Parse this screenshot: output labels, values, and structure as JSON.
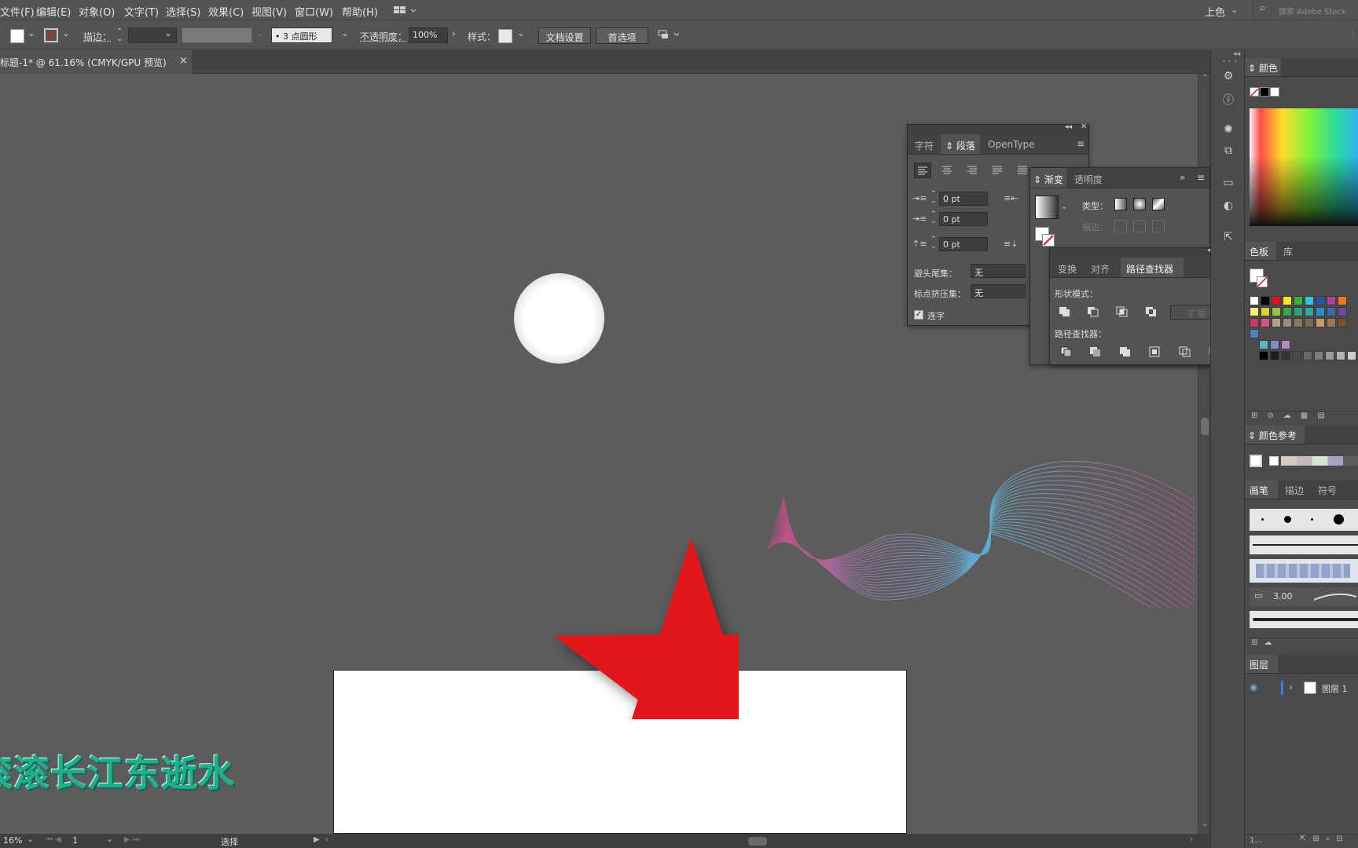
{
  "menubar": {
    "items": [
      "文件(F)",
      "编辑(E)",
      "对象(O)",
      "文字(T)",
      "选择(S)",
      "效果(C)",
      "视图(V)",
      "窗口(W)",
      "帮助(H)"
    ],
    "workspace": "上色",
    "search_placeholder": "搜索 Adobe Stock"
  },
  "control": {
    "stroke_label": "描边：",
    "brush_value": "3 点圆形",
    "opacity_label": "不透明度：",
    "opacity_value": "100%",
    "style_label": "样式：",
    "doc_setup": "文档设置",
    "prefs": "首选项"
  },
  "document": {
    "tab_title": "标题-1* @ 61.16% (CMYK/GPU 预览)",
    "close_glyph": "×"
  },
  "artwork": {
    "text": "滚滚长江东逝水",
    "star_color": "#e3131b",
    "text_color": "#1faf8c"
  },
  "status": {
    "zoom": "16%",
    "page": "1",
    "tool": "选择"
  },
  "para_panel": {
    "tabs": [
      "字符",
      "段落",
      "OpenType"
    ],
    "indent_values": [
      "0 pt",
      "0 pt",
      "0 pt"
    ],
    "kinsoku_label": "避头尾集：",
    "kinsoku_value": "无",
    "mojikumi_label": "标点挤压集：",
    "mojikumi_value": "无",
    "ligature_label": "连字"
  },
  "gradient_panel": {
    "tabs": [
      "渐变",
      "透明度"
    ],
    "type_label": "类型：",
    "stroke_label": "描边："
  },
  "pathfinder_panel": {
    "tabs": [
      "变换",
      "对齐",
      "路径查找器"
    ],
    "shape_modes_label": "形状模式：",
    "expand_label": "扩展",
    "pathfinders_label": "路径查找器："
  },
  "right": {
    "color_tab": "颜色",
    "swatches_tabs": [
      "色板",
      "库"
    ],
    "guide_tab": "颜色参考",
    "brush_tabs": [
      "画笔",
      "描边",
      "符号"
    ],
    "brush_size": "3.00",
    "layers_tab": "图层",
    "layer_name": "图层 1",
    "status_text": "1..."
  },
  "colors": {
    "ui_bg": "#535353",
    "canvas_bg": "#5c5c5c",
    "artboard": "#ffffff"
  }
}
